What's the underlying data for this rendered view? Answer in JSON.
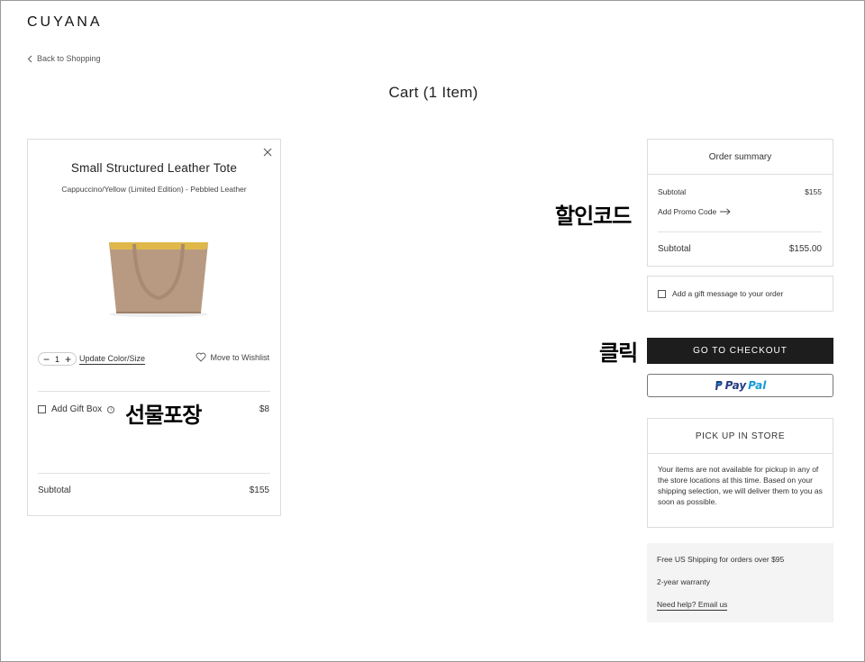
{
  "header": {
    "logo": "CUYANA",
    "back_link": "Back to Shopping",
    "page_title": "Cart (1 Item)"
  },
  "cart_item": {
    "name": "Small Structured Leather Tote",
    "variant": "Cappuccino/Yellow (Limited Edition) - Pebbled Leather",
    "quantity": "1",
    "update_link": "Update Color/Size",
    "wishlist": "Move to Wishlist",
    "gift_box_label": "Add Gift Box",
    "gift_box_price": "$8",
    "subtotal_label": "Subtotal",
    "subtotal_value": "$155"
  },
  "order_summary": {
    "title": "Order summary",
    "subtotal_label": "Subtotal",
    "subtotal_value": "$155",
    "promo_link": "Add Promo Code",
    "total_label": "Subtotal",
    "total_value": "$155.00"
  },
  "gift_message": "Add a gift message to your order",
  "checkout_button": "GO TO CHECKOUT",
  "paypal": {
    "part1": "Pay",
    "part2": "Pal"
  },
  "pickup": {
    "title": "PICK UP IN STORE",
    "body": "Your items are not available for pickup in any of the store locations at this time. Based on your shipping selection, we will deliver them to you as soon as possible."
  },
  "info": {
    "shipping": "Free US Shipping for orders over $95",
    "warranty": "2-year warranty",
    "help": "Need help? Email us"
  },
  "annotations": {
    "gift_wrap": "선물포장",
    "promo_code": "할인코드",
    "click": "클릭"
  },
  "colors": {
    "checkout_bg": "#1d1d1d",
    "paypal_dark": "#253b80",
    "paypal_light": "#179bd7",
    "bag_body": "#b89a82",
    "bag_lining": "#e0b84a"
  }
}
